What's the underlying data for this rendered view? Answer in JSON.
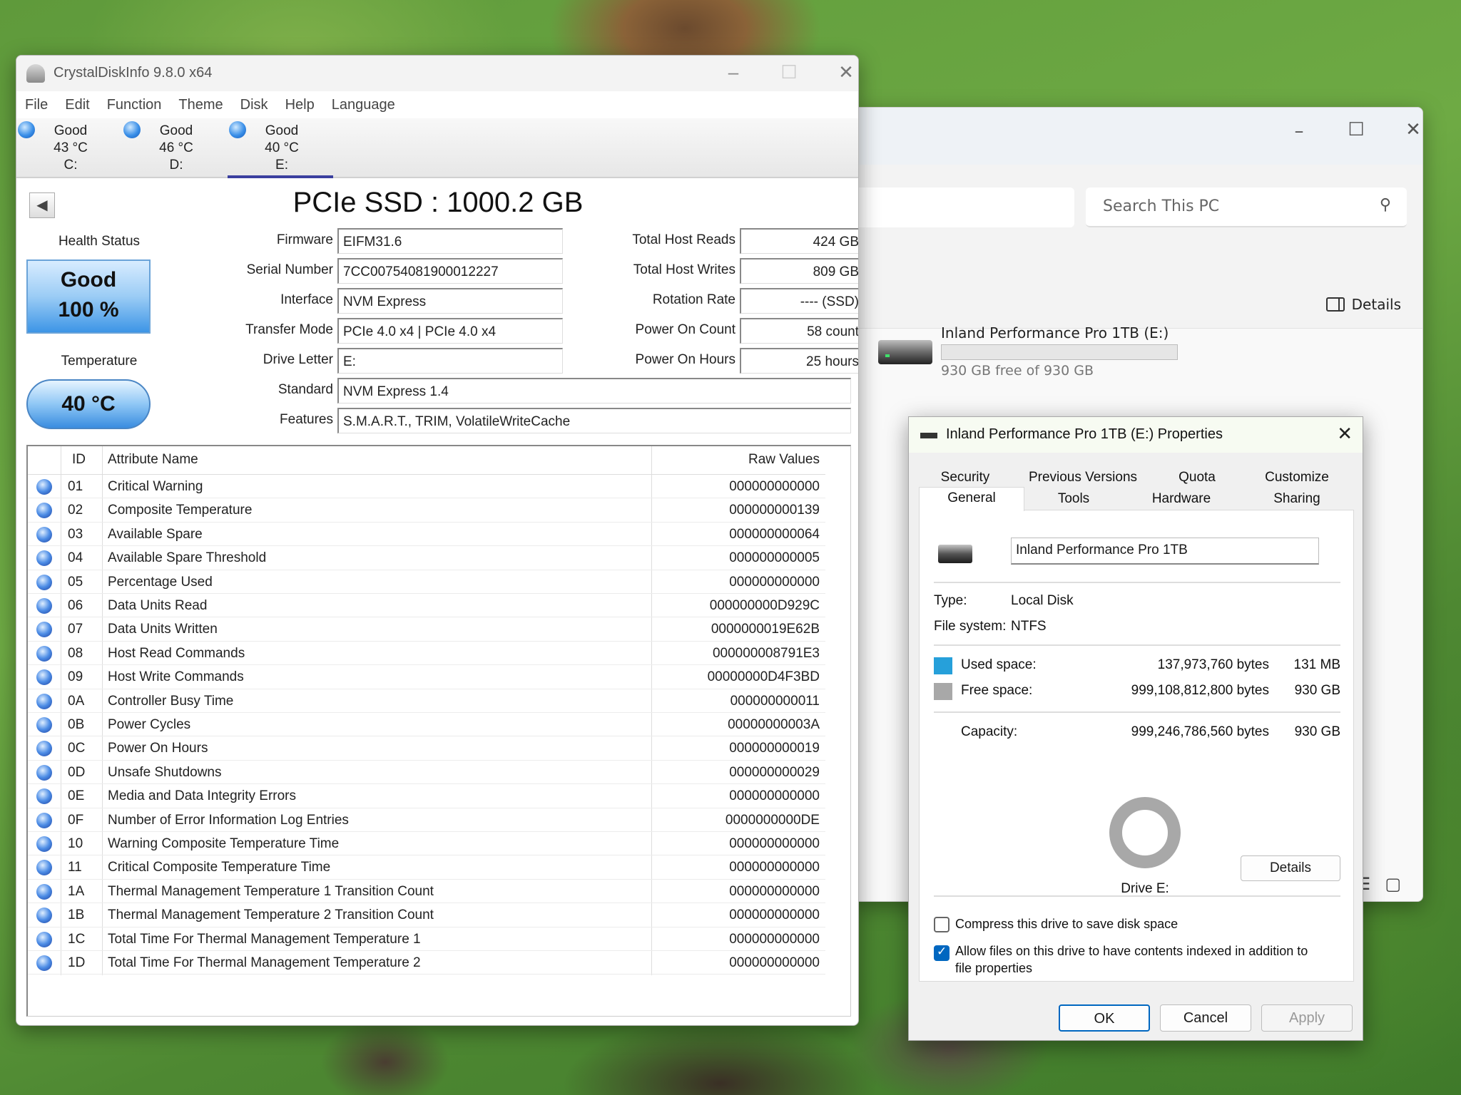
{
  "explorer": {
    "search_placeholder": "Search This PC",
    "details_label": "Details",
    "drive": {
      "name": "Inland Performance Pro 1TB (E:)",
      "free_text": "930 GB free of 930 GB",
      "used_fraction": 0.0
    }
  },
  "properties": {
    "title": "Inland Performance Pro 1TB (E:) Properties",
    "tabs_row1": [
      "Security",
      "Previous Versions",
      "Quota",
      "Customize"
    ],
    "tabs_row2": [
      "General",
      "Tools",
      "Hardware",
      "Sharing"
    ],
    "selected_tab": "General",
    "volume_name": "Inland Performance Pro 1TB",
    "type_label": "Type:",
    "type_value": "Local Disk",
    "fs_label": "File system:",
    "fs_value": "NTFS",
    "used_label": "Used space:",
    "used_bytes": "137,973,760 bytes",
    "used_size": "131 MB",
    "free_label": "Free space:",
    "free_bytes": "999,108,812,800 bytes",
    "free_size": "930 GB",
    "capacity_label": "Capacity:",
    "capacity_bytes": "999,246,786,560 bytes",
    "capacity_size": "930 GB",
    "drive_label": "Drive E:",
    "details_button": "Details",
    "compress_label": "Compress this drive to save disk space",
    "compress_checked": false,
    "index_label_1": "Allow files on this drive to have contents indexed in addition to",
    "index_label_2": "file properties",
    "index_checked": true,
    "ok": "OK",
    "cancel": "Cancel",
    "apply": "Apply",
    "colors": {
      "used": "#26a0da",
      "free": "#a8a8a8"
    }
  },
  "cdi": {
    "title": "CrystalDiskInfo 9.8.0 x64",
    "menu": [
      "File",
      "Edit",
      "Function",
      "Theme",
      "Disk",
      "Help",
      "Language"
    ],
    "drives": [
      {
        "status": "Good",
        "temp": "43 °C",
        "letter": "C:"
      },
      {
        "status": "Good",
        "temp": "46 °C",
        "letter": "D:"
      },
      {
        "status": "Good",
        "temp": "40 °C",
        "letter": "E:"
      }
    ],
    "heading": "PCIe SSD : 1000.2 GB",
    "health_label": "Health Status",
    "health_status": "Good",
    "health_percent": "100 %",
    "temp_label": "Temperature",
    "temp_value": "40 °C",
    "firmware_label": "Firmware",
    "firmware": "EIFM31.6",
    "serial_label": "Serial Number",
    "serial": "7CC00754081900012227",
    "interface_label": "Interface",
    "interface": "NVM Express",
    "transfer_label": "Transfer Mode",
    "transfer": "PCIe 4.0 x4 | PCIe 4.0 x4",
    "letter_label": "Drive Letter",
    "letter": "E:",
    "standard_label": "Standard",
    "standard": "NVM Express 1.4",
    "features_label": "Features",
    "features": "S.M.A.R.T., TRIM, VolatileWriteCache",
    "reads_label": "Total Host Reads",
    "reads": "424 GB",
    "writes_label": "Total Host Writes",
    "writes": "809 GB",
    "rotation_label": "Rotation Rate",
    "rotation": "---- (SSD)",
    "power_count_label": "Power On Count",
    "power_count": "58 count",
    "power_hours_label": "Power On Hours",
    "power_hours": "25 hours",
    "table_headers": {
      "id": "ID",
      "name": "Attribute Name",
      "raw": "Raw Values"
    },
    "attributes": [
      {
        "id": "01",
        "name": "Critical Warning",
        "raw": "000000000000"
      },
      {
        "id": "02",
        "name": "Composite Temperature",
        "raw": "000000000139"
      },
      {
        "id": "03",
        "name": "Available Spare",
        "raw": "000000000064"
      },
      {
        "id": "04",
        "name": "Available Spare Threshold",
        "raw": "000000000005"
      },
      {
        "id": "05",
        "name": "Percentage Used",
        "raw": "000000000000"
      },
      {
        "id": "06",
        "name": "Data Units Read",
        "raw": "000000000D929C"
      },
      {
        "id": "07",
        "name": "Data Units Written",
        "raw": "0000000019E62B"
      },
      {
        "id": "08",
        "name": "Host Read Commands",
        "raw": "000000008791E3"
      },
      {
        "id": "09",
        "name": "Host Write Commands",
        "raw": "00000000D4F3BD"
      },
      {
        "id": "0A",
        "name": "Controller Busy Time",
        "raw": "000000000011"
      },
      {
        "id": "0B",
        "name": "Power Cycles",
        "raw": "00000000003A"
      },
      {
        "id": "0C",
        "name": "Power On Hours",
        "raw": "000000000019"
      },
      {
        "id": "0D",
        "name": "Unsafe Shutdowns",
        "raw": "000000000029"
      },
      {
        "id": "0E",
        "name": "Media and Data Integrity Errors",
        "raw": "000000000000"
      },
      {
        "id": "0F",
        "name": "Number of Error Information Log Entries",
        "raw": "0000000000DE"
      },
      {
        "id": "10",
        "name": "Warning Composite Temperature Time",
        "raw": "000000000000"
      },
      {
        "id": "11",
        "name": "Critical Composite Temperature Time",
        "raw": "000000000000"
      },
      {
        "id": "1A",
        "name": "Thermal Management Temperature 1 Transition Count",
        "raw": "000000000000"
      },
      {
        "id": "1B",
        "name": "Thermal Management Temperature 2 Transition Count",
        "raw": "000000000000"
      },
      {
        "id": "1C",
        "name": "Total Time For Thermal Management Temperature 1",
        "raw": "000000000000"
      },
      {
        "id": "1D",
        "name": "Total Time For Thermal Management Temperature 2",
        "raw": "000000000000"
      }
    ]
  }
}
